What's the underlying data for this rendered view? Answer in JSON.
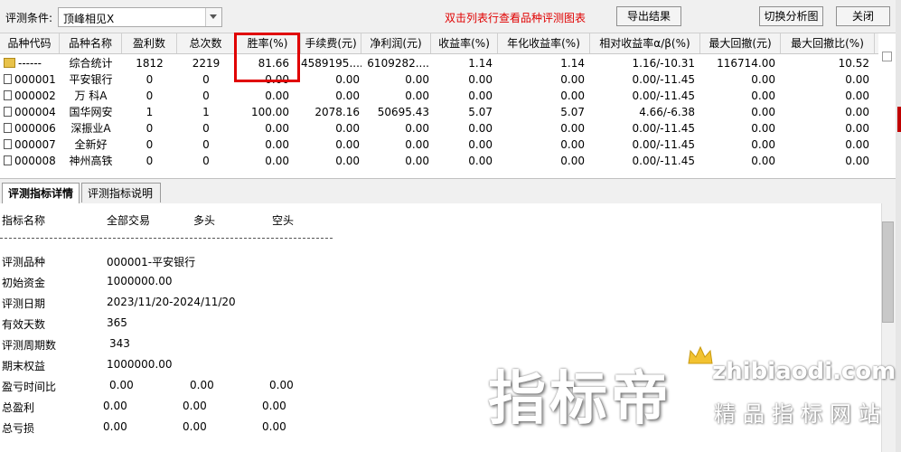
{
  "toolbar": {
    "condition_label": "评测条件:",
    "condition_value": "顶峰相见X",
    "hint": "双击列表行查看品种评测图表",
    "export_label": "导出结果",
    "switch_label": "切换分析图",
    "close_label": "关闭"
  },
  "grid": {
    "columns": [
      "品种代码",
      "品种名称",
      "盈利数",
      "总次数",
      "胜率(%)",
      "手续费(元)",
      "净利润(元)",
      "收益率(%)",
      "年化收益率(%)",
      "相对收益率α/β(%)",
      "最大回撤(元)",
      "最大回撤比(%)"
    ],
    "rows": [
      {
        "code": "------",
        "name": "综合统计",
        "profit_count": "1812",
        "total_count": "2219",
        "win_rate": "81.66",
        "fee": "4589195....",
        "net_profit": "6109282....",
        "return": "1.14",
        "annual_return": "1.14",
        "alpha_beta": "1.16/-10.31",
        "max_drawdown": "116714.00",
        "max_drawdown_ratio": "10.52"
      },
      {
        "code": "000001",
        "name": "平安银行",
        "profit_count": "0",
        "total_count": "0",
        "win_rate": "0.00",
        "fee": "0.00",
        "net_profit": "0.00",
        "return": "0.00",
        "annual_return": "0.00",
        "alpha_beta": "0.00/-11.45",
        "max_drawdown": "0.00",
        "max_drawdown_ratio": "0.00"
      },
      {
        "code": "000002",
        "name": "万 科A",
        "profit_count": "0",
        "total_count": "0",
        "win_rate": "0.00",
        "fee": "0.00",
        "net_profit": "0.00",
        "return": "0.00",
        "annual_return": "0.00",
        "alpha_beta": "0.00/-11.45",
        "max_drawdown": "0.00",
        "max_drawdown_ratio": "0.00"
      },
      {
        "code": "000004",
        "name": "国华网安",
        "profit_count": "1",
        "total_count": "1",
        "win_rate": "100.00",
        "fee": "2078.16",
        "net_profit": "50695.43",
        "return": "5.07",
        "annual_return": "5.07",
        "alpha_beta": "4.66/-6.38",
        "max_drawdown": "0.00",
        "max_drawdown_ratio": "0.00"
      },
      {
        "code": "000006",
        "name": "深振业A",
        "profit_count": "0",
        "total_count": "0",
        "win_rate": "0.00",
        "fee": "0.00",
        "net_profit": "0.00",
        "return": "0.00",
        "annual_return": "0.00",
        "alpha_beta": "0.00/-11.45",
        "max_drawdown": "0.00",
        "max_drawdown_ratio": "0.00"
      },
      {
        "code": "000007",
        "name": "全新好",
        "profit_count": "0",
        "total_count": "0",
        "win_rate": "0.00",
        "fee": "0.00",
        "net_profit": "0.00",
        "return": "0.00",
        "annual_return": "0.00",
        "alpha_beta": "0.00/-11.45",
        "max_drawdown": "0.00",
        "max_drawdown_ratio": "0.00"
      },
      {
        "code": "000008",
        "name": "神州高铁",
        "profit_count": "0",
        "total_count": "0",
        "win_rate": "0.00",
        "fee": "0.00",
        "net_profit": "0.00",
        "return": "0.00",
        "annual_return": "0.00",
        "alpha_beta": "0.00/-11.45",
        "max_drawdown": "0.00",
        "max_drawdown_ratio": "0.00"
      }
    ]
  },
  "tabs": {
    "detail": "评测指标详情",
    "explain": "评测指标说明"
  },
  "detail": {
    "header": {
      "name": "指标名称",
      "all": "全部交易",
      "long": "多头",
      "short": "空头"
    },
    "items": [
      {
        "label": "评测品种",
        "value": "000001-平安银行"
      },
      {
        "label": "初始资金",
        "value": "1000000.00"
      },
      {
        "label": "评测日期",
        "value": "2023/11/20-2024/11/20"
      },
      {
        "label": "有效天数",
        "value": "365"
      },
      {
        "label": "评测周期数",
        "value": "343"
      },
      {
        "label": "期末权益",
        "value": "1000000.00"
      }
    ],
    "stats": [
      {
        "label": "盈亏时间比",
        "all": "0.00",
        "long": "0.00",
        "short": "0.00"
      },
      {
        "label": "总盈利",
        "all": "0.00",
        "long": "0.00",
        "short": "0.00"
      },
      {
        "label": "总亏损",
        "all": "0.00",
        "long": "0.00",
        "short": "0.00"
      }
    ]
  },
  "watermark": {
    "brand": "指标帝",
    "url": "zhibiaodi.com",
    "slogan": "精品指标网站"
  }
}
